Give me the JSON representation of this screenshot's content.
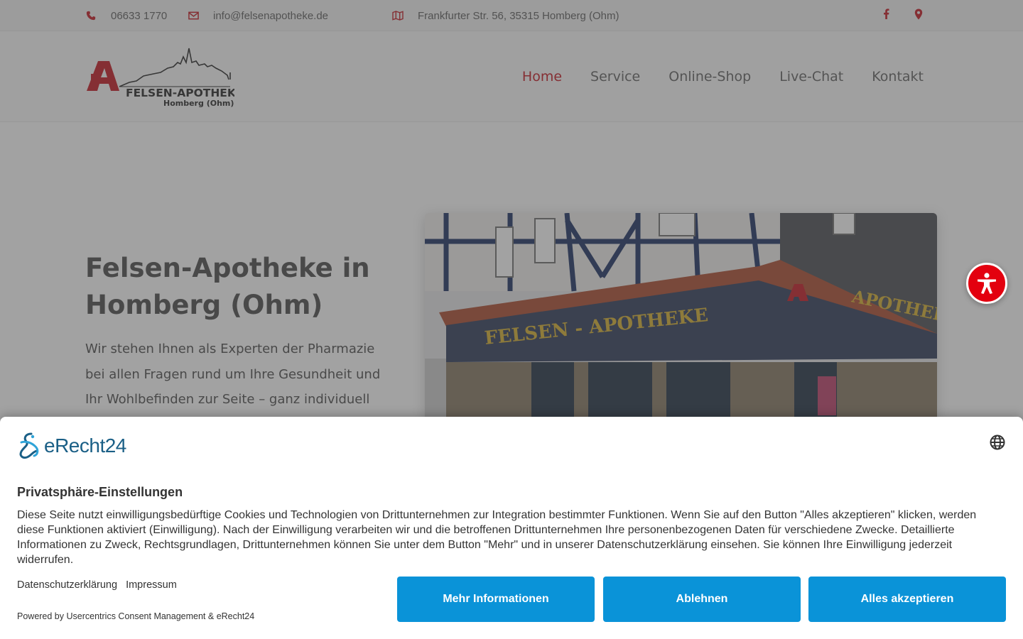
{
  "topbar": {
    "phone": "06633 1770",
    "email": "info@felsenapotheke.de",
    "address": "Frankfurter Str. 56, 35315 Homberg (Ohm)",
    "accent": "#c8232c"
  },
  "logo": {
    "name": "FELSEN-APOTHEKE",
    "sub": "Homberg (Ohm)"
  },
  "nav": {
    "items": [
      "Home",
      "Service",
      "Online-Shop",
      "Live-Chat",
      "Kontakt"
    ],
    "active": "Home"
  },
  "hero": {
    "title": "Felsen-Apotheke in Homberg (Ohm)",
    "text": "Wir stehen Ihnen als Experten der Pharmazie bei allen Fragen rund um Ihre Gesundheit und Ihr Wohlbefinden zur Seite – ganz individuell",
    "photo_sign_left": "FELSEN - APOTHEKE",
    "photo_sign_right": "APOTHEKE"
  },
  "consent": {
    "brand": "eRecht24",
    "title": "Privatsphäre-Einstellungen",
    "description": "Diese Seite nutzt einwilligungsbedürftige Cookies und Technologien von Drittunternehmen zur Integration bestimmter Funktionen. Wenn Sie auf den Button \"Alles akzeptieren\" klicken, werden diese Funktionen aktiviert (Einwilligung). Nach der Einwilligung verarbeiten wir und die betroffenen Drittunternehmen Ihre personenbezogenen Daten für verschiedene Zwecke. Detaillierte Informationen zu Zweck, Rechtsgrundlagen, Drittunternehmen können Sie unter dem Button \"Mehr\" und in unserer Datenschutzerklärung einsehen. Sie können Ihre Einwilligung jederzeit widerrufen.",
    "link_privacy": "Datenschutzerklärung",
    "link_imprint": "Impressum",
    "powered": "Powered by Usercentrics Consent Management & eRecht24",
    "btn_more": "Mehr Informationen",
    "btn_decline": "Ablehnen",
    "btn_accept": "Alles akzeptieren",
    "button_color": "#0a93d8"
  },
  "icons": {
    "phone": "phone-icon",
    "email": "envelope-icon",
    "map": "map-icon",
    "facebook": "facebook-icon",
    "location": "map-pin-icon",
    "accessibility": "accessibility-icon",
    "language": "globe-icon"
  }
}
